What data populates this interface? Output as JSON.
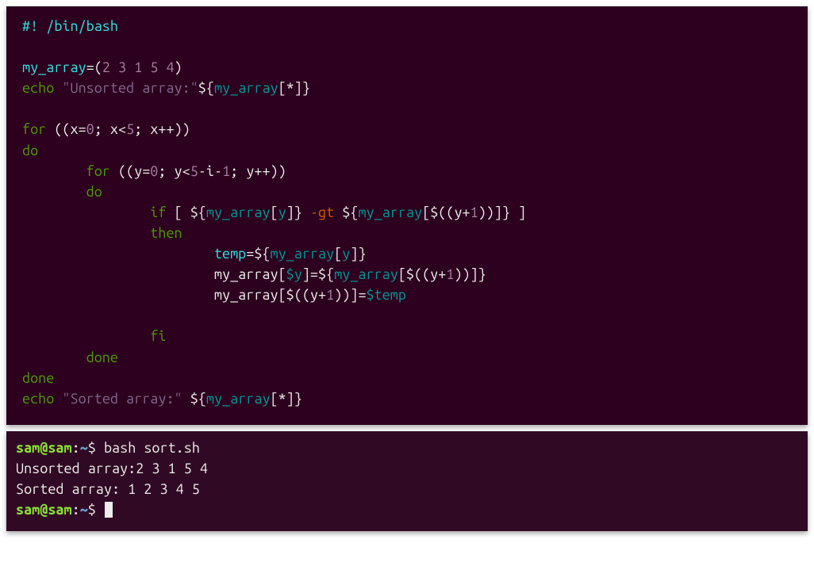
{
  "editor": {
    "shebang_prefix": "#!",
    "shebang_path": " /bin/bash",
    "var_name": "my_array",
    "assign_op": "=(",
    "array_values": "2 3 1 5 4",
    "assign_close": ")",
    "echo_kw": "echo",
    "echo_unsorted_open": " \"",
    "echo_unsorted_str": "Unsorted array:",
    "echo_unsorted_close": "\"",
    "expand_open": "${",
    "expand_var": "my_array",
    "expand_idx_open": "[",
    "expand_idx_star": "*",
    "expand_idx_close": "]",
    "expand_close": "}",
    "for_kw": "for",
    "for_outer": " ((x=",
    "for_outer_0": "0",
    "for_outer_mid": "; x<",
    "for_outer_5": "5",
    "for_outer_end": "; x++))",
    "do_kw": "do",
    "for_inner": " ((y=",
    "for_inner_0": "0",
    "for_inner_mid": "; y<",
    "for_inner_5": "5",
    "for_inner_mid2": "-i-",
    "for_inner_1": "1",
    "for_inner_end": "; y++))",
    "if_kw": "if",
    "if_bracket_open": " [ ",
    "left_expand_open": "${",
    "left_var": "my_array",
    "left_idx_open": "[",
    "left_idx": "y",
    "left_idx_close": "]",
    "left_expand_close": "}",
    "gt_op": " -gt ",
    "right_expand_open": "${",
    "right_var": "my_array",
    "right_idx_open": "[",
    "right_arith_open": "$((",
    "right_arith_expr_a": "y+",
    "right_arith_expr_b": "1",
    "right_arith_close": "))",
    "right_idx_close": "]",
    "right_expand_close": "}",
    "if_bracket_close": " ]",
    "then_kw": "then",
    "temp_decl": "temp",
    "temp_eq": "=",
    "swap2_lhs1": "my_array",
    "swap2_lhs2": "[",
    "swap2_lhs3": "$y",
    "swap2_lhs4": "]",
    "swap3_lhs_open": "[",
    "swap3_arith_open": "$((",
    "swap3_expr_a": "y+",
    "swap3_expr_b": "1",
    "swap3_arith_close": "))",
    "swap3_lhs_close": "]",
    "swap3_eq": "=",
    "swap3_rhs": "$temp",
    "fi_kw": "fi",
    "done_kw": "done",
    "echo_sorted_str": "Sorted array:",
    "indent1": "        ",
    "indent2": "                ",
    "indent3": "                        "
  },
  "output": {
    "user": "sam",
    "host": "sam",
    "path": "~",
    "sep1": "@",
    "sep2": ":",
    "sigil": "$ ",
    "cmd1": "bash sort.sh",
    "line1": "Unsorted array:2 3 1 5 4",
    "line2": "Sorted array: 1 2 3 4 5"
  }
}
